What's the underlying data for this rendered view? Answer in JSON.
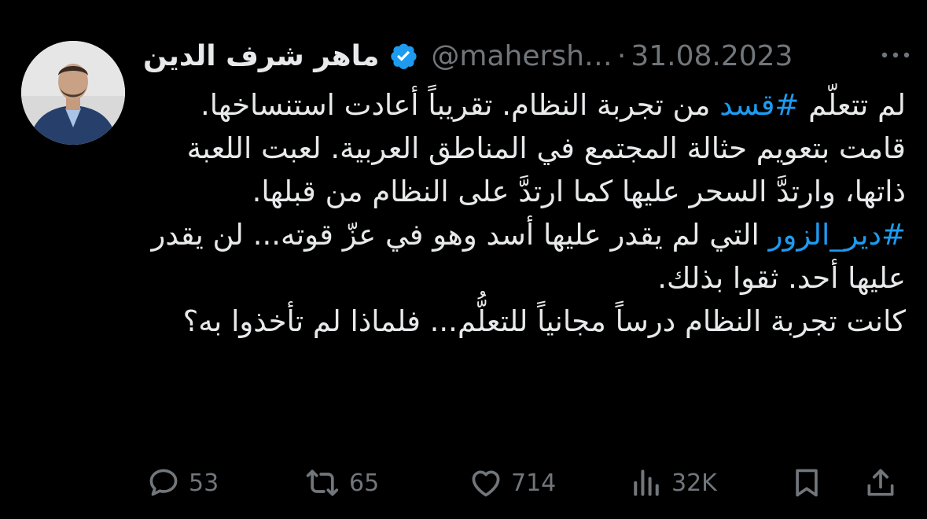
{
  "author": {
    "display_name": "ماهر شرف الدين",
    "handle": "@mahersh…",
    "separator": "·",
    "date": "31.08.2023"
  },
  "tweet": {
    "p1_before": "لم تتعلّم ",
    "p1_hashtag": "#قسد",
    "p1_after": " من تجربة النظام. تقريباً أعادت استنساخها. قامت بتعويم حثالة المجتمع في المناطق العربية. لعبت اللعبة ذاتها، وارتدَّ السحر عليها كما ارتدَّ على النظام من قبلها.",
    "p2_hashtag": "#دير_الزور",
    "p2_after": "  التي لم يقدر عليها أسد وهو في عزّ قوته... لن يقدر عليها أحد. ثقوا بذلك.",
    "p3": "كانت تجربة النظام درساً مجانياً للتعلُّم... فلماذا لم تأخذوا به؟"
  },
  "stats": {
    "replies": "53",
    "reposts": "65",
    "likes": "714",
    "views": "32K"
  },
  "colors": {
    "background": "#000000",
    "text": "#e7e9ea",
    "muted": "#71767b",
    "accent": "#1d9bf0"
  },
  "icons": {
    "verified": "verified-badge-icon",
    "more": "more-dots-icon",
    "reply": "reply-bubble-icon",
    "repost": "repost-icon",
    "like": "heart-icon",
    "views": "views-bars-icon",
    "bookmark": "bookmark-icon",
    "share": "share-icon"
  }
}
